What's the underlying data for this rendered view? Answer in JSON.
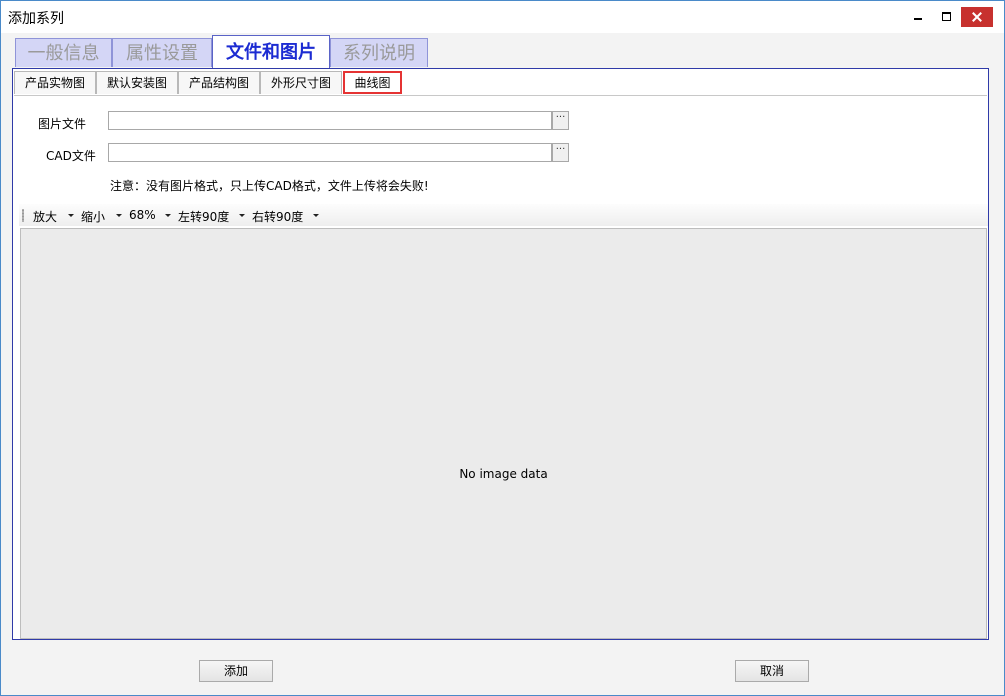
{
  "window": {
    "title": "添加系列",
    "controls": {
      "minimize": "minimize-icon",
      "maximize": "maximize-icon",
      "close": "close-icon"
    }
  },
  "main_tabs": [
    {
      "label": "一般信息"
    },
    {
      "label": "属性设置"
    },
    {
      "label": "文件和图片",
      "active": true
    },
    {
      "label": "系列说明"
    }
  ],
  "sub_tabs": [
    {
      "label": "产品实物图"
    },
    {
      "label": "默认安装图"
    },
    {
      "label": "产品结构图"
    },
    {
      "label": "外形尺寸图"
    },
    {
      "label": "曲线图",
      "active": true
    }
  ],
  "form": {
    "image_file_label": "图片文件",
    "image_file_value": "",
    "cad_file_label": "CAD文件",
    "cad_file_value": "",
    "browse_label": "···",
    "notice": "注意：没有图片格式，只上传CAD格式，文件上传将会失败!"
  },
  "image_toolbar": {
    "zoom_in": "放大",
    "zoom_out": "缩小",
    "zoom_level": "68%",
    "rotate_left": "左转90度",
    "rotate_right": "右转90度"
  },
  "image_area": {
    "placeholder": "No image data"
  },
  "footer": {
    "add_button": "添加",
    "cancel_button": "取消"
  },
  "colors": {
    "active_tab_text": "#1c2bd2",
    "inactive_tab_bg": "#d4d6f6",
    "highlight_border": "#e53333",
    "close_button_bg": "#c7312e"
  }
}
